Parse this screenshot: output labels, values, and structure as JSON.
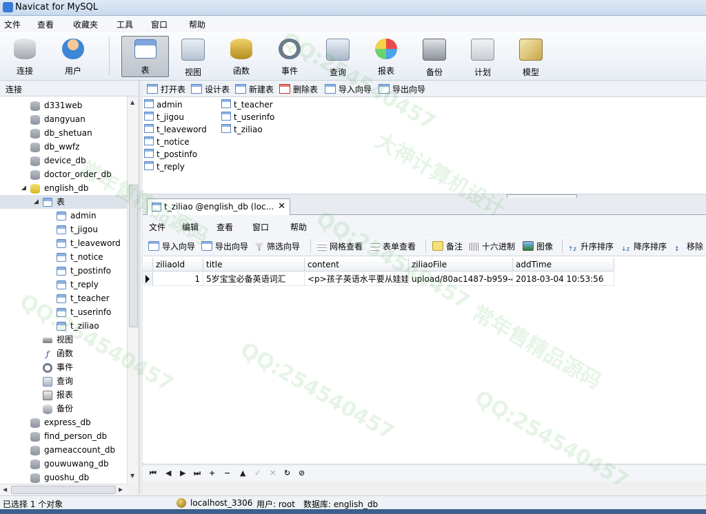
{
  "window": {
    "title": "Navicat for MySQL"
  },
  "menubar": [
    "文件",
    "查看",
    "收藏夹",
    "工具",
    "窗口",
    "帮助"
  ],
  "toolbar": {
    "items": [
      "连接",
      "用户",
      "表",
      "视图",
      "函数",
      "事件",
      "查询",
      "报表",
      "备份",
      "计划",
      "模型"
    ],
    "active": "表"
  },
  "left_panel": {
    "header": "连接",
    "databases_top": [
      "d331web",
      "dangyuan",
      "db_shetuan",
      "db_wwfz",
      "device_db",
      "doctor_order_db"
    ],
    "open_db": "english_db",
    "tables_node": "表",
    "tables": [
      "admin",
      "t_jigou",
      "t_leaveword",
      "t_notice",
      "t_postinfo",
      "t_reply",
      "t_teacher",
      "t_userinfo",
      "t_ziliao"
    ],
    "other_nodes": [
      "视图",
      "函数",
      "事件",
      "查询",
      "报表",
      "备份"
    ],
    "databases_bottom": [
      "express_db",
      "find_person_db",
      "gameaccount_db",
      "gouwuwang_db",
      "guoshu_db"
    ]
  },
  "object_toolbar": [
    "打开表",
    "设计表",
    "新建表",
    "删除表",
    "导入向导",
    "导出向导"
  ],
  "object_list": {
    "col1": [
      "admin",
      "t_jigou",
      "t_leaveword",
      "t_notice",
      "t_postinfo",
      "t_reply"
    ],
    "col2": [
      "t_teacher",
      "t_userinfo",
      "t_ziliao"
    ]
  },
  "doc_tab": {
    "label": "t_ziliao @english_db (loc...",
    "close": "✕"
  },
  "inner_menu": [
    "文件",
    "编辑",
    "查看",
    "窗口",
    "帮助"
  ],
  "inner_tools": [
    "导入向导",
    "导出向导",
    "筛选向导",
    "网格查看",
    "表单查看",
    "备注",
    "十六进制",
    "图像",
    "升序排序",
    "降序排序",
    "移除"
  ],
  "grid": {
    "columns": [
      "ziliaoId",
      "title",
      "content",
      "ziliaoFile",
      "addTime"
    ],
    "rows": [
      [
        "1",
        "5岁宝宝必备英语词汇",
        "<p>孩子英语水平要从娃娃",
        "upload/80ac1487-b959-4",
        "2018-03-04 10:53:56"
      ]
    ]
  },
  "nav_buttons": [
    "⏮",
    "◀",
    "▶",
    "⏭",
    "+",
    "−",
    "▲",
    "✓",
    "✕",
    "↻",
    "⊘"
  ],
  "statusbar": {
    "selection": "已选择 1 个对象",
    "host": "localhost_3306",
    "user": "用户: root",
    "db": "数据库: english_db"
  },
  "watermark": {
    "qq": "QQ:254540457",
    "slogan1": "大神计算机设计",
    "slogan2": "常年售精品源码"
  }
}
